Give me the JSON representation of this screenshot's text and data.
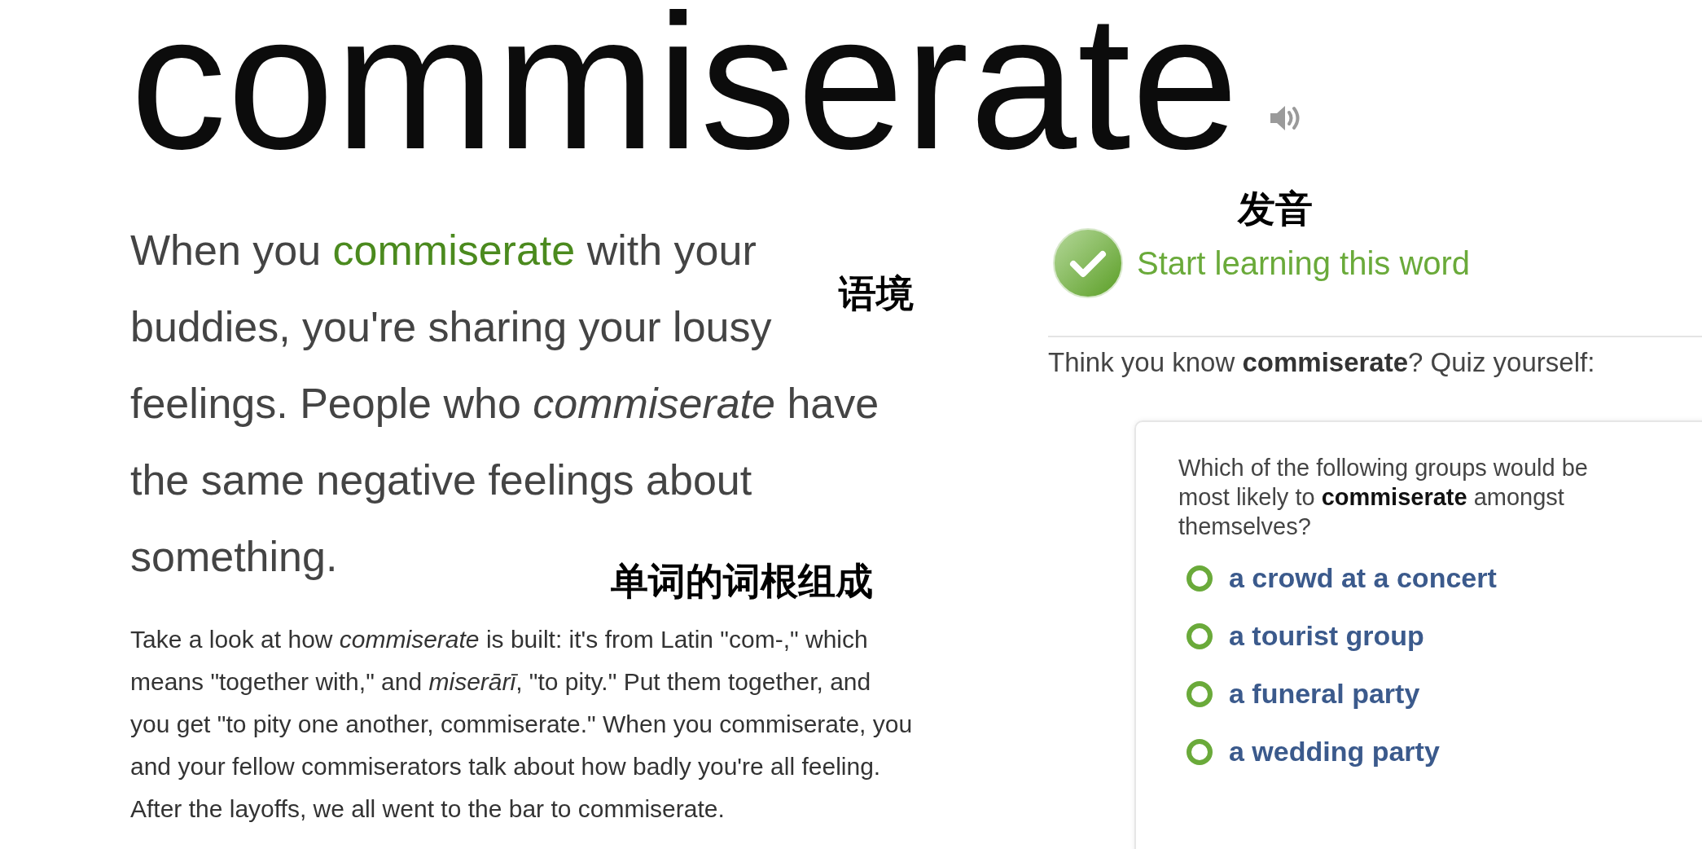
{
  "title": {
    "word": "commiserate"
  },
  "annotations": [
    {
      "text": "发音"
    },
    {
      "text": "语境"
    },
    {
      "text": "单词的词根组成"
    }
  ],
  "blurb": {
    "lead": "When you ",
    "link": "commiserate",
    "rest": [
      " with your",
      "buddies, you're sharing your lousy",
      "feelings. People who *commiserate* have",
      "the same negative feelings about",
      "something."
    ]
  },
  "paragraph": {
    "lines": [
      "Take a look at how *commiserate* is built: it's from Latin \"com-,\" which",
      "means \"together with,\" and *miserārī*, \"to pity.\" Put them together, and",
      "you get \"to pity one another, commiserate.\" When you commiserate, you",
      "and your fellow commiserators talk about how badly you're all feeling.",
      "After the layoffs, we all went to the bar to commiserate."
    ]
  },
  "learn": {
    "label": "Start learning this word"
  },
  "quiz_prompt": "Think you know **commiserate**? Quiz yourself:",
  "quiz": {
    "question_lines": [
      "Which of the following groups would be",
      "most likely to **commiserate** amongst",
      "themselves?"
    ],
    "options": [
      {
        "label": "a crowd at a concert",
        "selected": false
      },
      {
        "label": "a tourist group",
        "selected": false
      },
      {
        "label": "a funeral party",
        "selected": false
      },
      {
        "label": "a wedding party",
        "selected": false
      }
    ]
  }
}
